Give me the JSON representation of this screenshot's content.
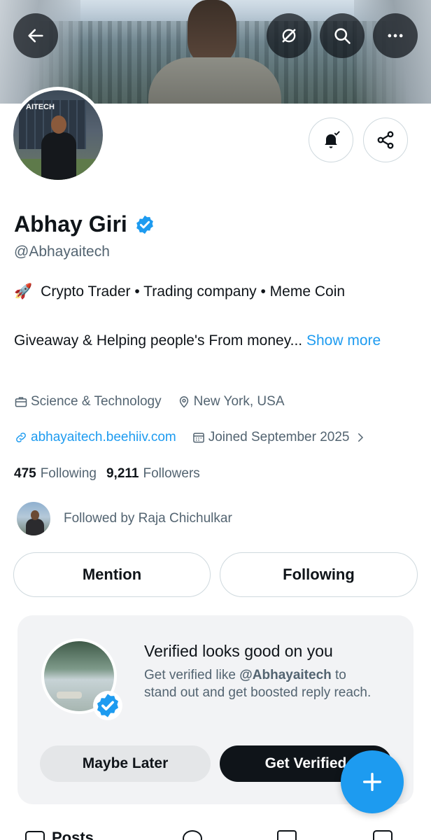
{
  "header": {
    "back_icon": "arrow-left-icon",
    "actions": [
      "grok-icon",
      "search-icon",
      "more-icon"
    ]
  },
  "profile": {
    "name": "Abhay Giri",
    "handle": "@Abhayaitech",
    "avatar_logo": "AITECH",
    "bio_line1": "Crypto Trader •  Trading company • Meme Coin",
    "bio_line2": "Giveaway & Helping people's From money...",
    "show_more": "Show more",
    "category": "Science & Technology",
    "location": "New York, USA",
    "website": "abhayaitech.beehiiv.com",
    "joined": "Joined September 2025",
    "following_count": "475",
    "following_label": "Following",
    "followers_count": "9,211",
    "followers_label": "Followers",
    "followed_by": "Followed by Raja Chichulkar"
  },
  "actions": {
    "mention": "Mention",
    "following": "Following"
  },
  "verified_card": {
    "title": "Verified looks good on you",
    "desc_prefix": "Get verified like ",
    "desc_handle": "@Abhayaitech",
    "desc_suffix": " to stand out and get boosted reply reach.",
    "maybe_later": "Maybe Later",
    "get_verified": "Get Verified"
  },
  "tabs": {
    "posts": "Posts"
  },
  "colors": {
    "accent": "#1d9bf0",
    "text": "#0f1419",
    "muted": "#536471"
  }
}
